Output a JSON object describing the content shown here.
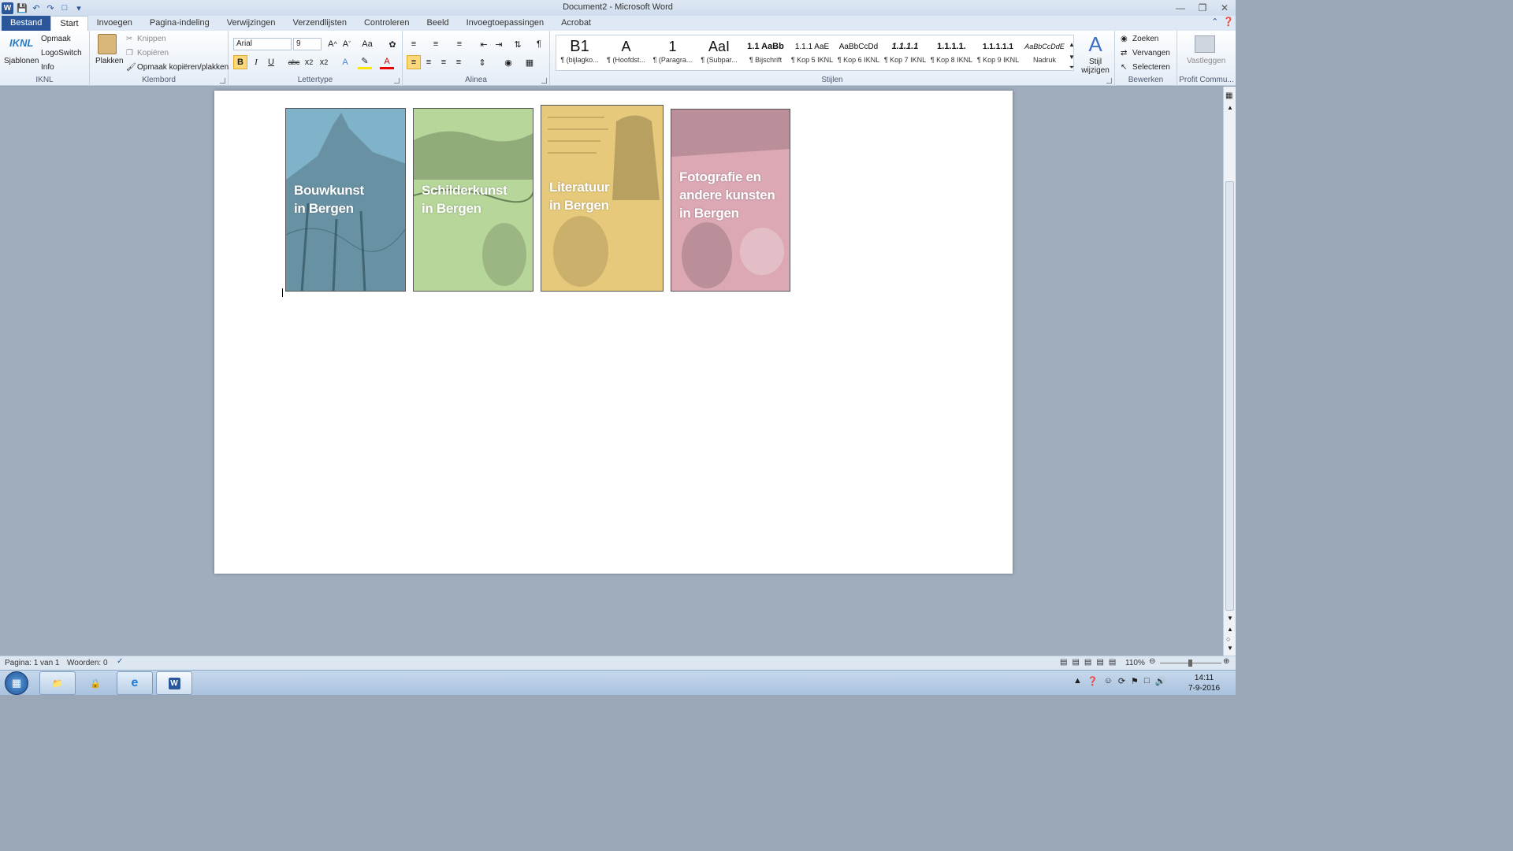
{
  "window": {
    "title": "Document2 - Microsoft Word"
  },
  "tabs": [
    "Bestand",
    "Start",
    "Invoegen",
    "Pagina-indeling",
    "Verwijzingen",
    "Verzendlijsten",
    "Controleren",
    "Beeld",
    "Invoegtoepassingen",
    "Acrobat"
  ],
  "groups": {
    "iknl": {
      "label": "IKNL",
      "sjablonen": "Sjablonen",
      "opmaak": "Opmaak",
      "logoswitch": "LogoSwitch",
      "info": "Info",
      "logo": "IKNL"
    },
    "klembord": {
      "label": "Klembord",
      "plakken": "Plakken",
      "knippen": "Knippen",
      "kopieren": "Kopiëren",
      "opmaak_kopieren": "Opmaak kopiëren/plakken"
    },
    "lettertype": {
      "label": "Lettertype",
      "font": "Arial",
      "size": "9"
    },
    "alinea": {
      "label": "Alinea"
    },
    "stijlen": {
      "label": "Stijlen",
      "stijl_wijzigen": "Stijl wijzigen"
    },
    "bewerken": {
      "label": "Bewerken",
      "zoeken": "Zoeken",
      "vervangen": "Vervangen",
      "selecteren": "Selecteren"
    },
    "profit": {
      "label": "Profit Commu...",
      "vastleggen": "Vastleggen"
    }
  },
  "styles": [
    {
      "preview": "B1",
      "name": "¶ (bijlagko..."
    },
    {
      "preview": "A",
      "name": "¶ (Hoofdst..."
    },
    {
      "preview": "1",
      "name": "¶ (Paragra..."
    },
    {
      "preview": "AaI",
      "name": "¶ (Subpar..."
    },
    {
      "preview": "1.1  AaBb",
      "name": "¶ Bijschrift"
    },
    {
      "preview": "1.1.1  AaE",
      "name": "¶ Kop 5 IKNL"
    },
    {
      "preview": "AaBbCcDd",
      "name": "¶ Kop 6 IKNL"
    },
    {
      "preview": "1.1.1.1",
      "name": "¶ Kop 7 IKNL"
    },
    {
      "preview": "1.1.1.1.",
      "name": "¶ Kop 8 IKNL"
    },
    {
      "preview": "1.1.1.1.1",
      "name": "¶ Kop 9 IKNL"
    },
    {
      "preview": "AaBbCcDdE",
      "name": "Nadruk"
    }
  ],
  "covers": [
    {
      "title1": "Bouwkunst",
      "title2": "in Bergen",
      "title3": "",
      "color": "#7fb3c9"
    },
    {
      "title1": "Schilderkunst",
      "title2": "in Bergen",
      "title3": "",
      "color": "#b7d69a"
    },
    {
      "title1": "Literatuur",
      "title2": "in Bergen",
      "title3": "",
      "color": "#e6c97a"
    },
    {
      "title1": "Fotografie en",
      "title2": "andere kunsten",
      "title3": "in Bergen",
      "color": "#dba8b4"
    }
  ],
  "status": {
    "page": "Pagina: 1 van 1",
    "words": "Woorden: 0",
    "zoom": "110%"
  },
  "taskbar": {
    "time": "14:11",
    "date": "7-9-2016"
  }
}
